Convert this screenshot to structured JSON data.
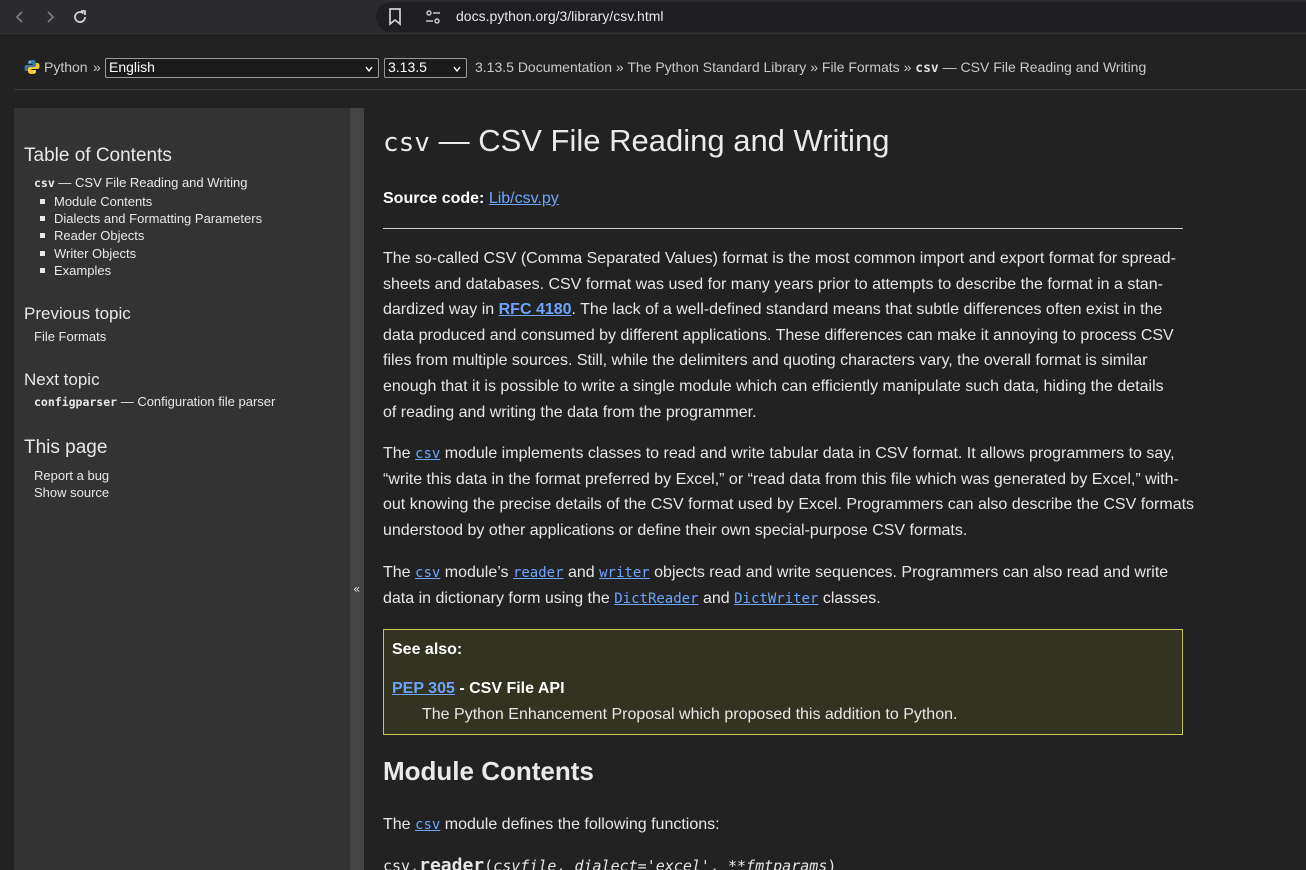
{
  "browser": {
    "url": "docs.python.org/3/library/csv.html"
  },
  "header": {
    "python_label": "Python",
    "separator": "»",
    "language_select": "English",
    "version_select": "3.13.5",
    "crumb_docs": "3.13.5 Documentation",
    "crumb_stdlib": "The Python Standard Library",
    "crumb_formats": "File Formats",
    "crumb_sep": "»",
    "crumb_current_mono": "csv",
    "crumb_current_text": " — CSV File Reading and Writing"
  },
  "sidebar": {
    "toc_heading": "Table of Contents",
    "toc_root_mono": "csv",
    "toc_root_text": " — CSV File Reading and Writing",
    "toc_items": [
      "Module Contents",
      "Dialects and Formatting Parameters",
      "Reader Objects",
      "Writer Objects",
      "Examples"
    ],
    "prev_heading": "Previous topic",
    "prev_link": "File Formats",
    "next_heading": "Next topic",
    "next_link_mono": "configparser",
    "next_link_text": " — Configuration file parser",
    "page_heading": "This page",
    "page_links": [
      "Report a bug",
      "Show source"
    ],
    "collapse_glyph": "«"
  },
  "main": {
    "title_mono": "csv",
    "title_text": " — CSV File Reading and Writing",
    "source_label": "Source code:",
    "source_link": "Lib/csv.py",
    "p1": {
      "l1": "The so-called CSV (Comma Separated Values) format is the most common import and export format for spread-",
      "l2": "sheets and databases. CSV format was used for many years prior to attempts to describe the format in a stan-",
      "l3a": "dardized way in ",
      "l3link": "RFC 4180",
      "l3b": ". The lack of a well-defined standard means that subtle differences often exist in the",
      "l4": "data produced and consumed by different applications. These differences can make it annoying to process CSV",
      "l5": "files from multiple sources. Still, while the delimiters and quoting characters vary, the overall format is similar",
      "l6": "enough that it is possible to write a single module which can efficiently manipulate such data, hiding the details",
      "l7": "of reading and writing the data from the programmer."
    },
    "p2": {
      "l1a": "The ",
      "l1code": "csv",
      "l1b": " module implements classes to read and write tabular data in CSV format. It allows programmers to say,",
      "l2": "“write this data in the format preferred by Excel,” or “read data from this file which was generated by Excel,” with-",
      "l3": "out knowing the precise details of the CSV format used by Excel. Programmers can also describe the CSV formats",
      "l4": "understood by other applications or define their own special-purpose CSV formats."
    },
    "p3": {
      "l1a": "The ",
      "l1code1": "csv",
      "l1b": " module’s ",
      "l1code2": "reader",
      "l1c": " and ",
      "l1code3": "writer",
      "l1d": " objects read and write sequences. Programmers can also read and write",
      "l2a": "data in dictionary form using the ",
      "l2code1": "DictReader",
      "l2b": " and ",
      "l2code2": "DictWriter",
      "l2c": " classes."
    },
    "seealso": {
      "title": "See also:",
      "pep_link": "PEP 305",
      "pep_rest": " - CSV File API",
      "desc": "The Python Enhancement Proposal which proposed this addition to Python."
    },
    "module_contents_heading": "Module Contents",
    "p4a": "The ",
    "p4code": "csv",
    "p4b": " module defines the following functions:",
    "sig": {
      "prefix": "csv.",
      "name": "reader",
      "open": "(",
      "p1": "csvfile",
      "comma": ", ",
      "p2": "dialect='excel'",
      "comma2": ", ",
      "p3": "**fmtparams",
      "close": ")"
    }
  }
}
